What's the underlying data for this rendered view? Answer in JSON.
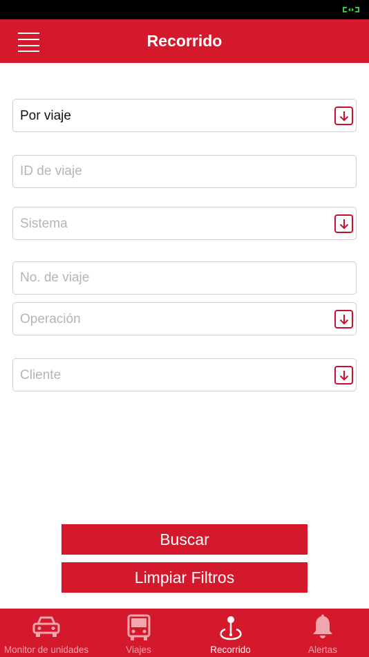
{
  "header": {
    "title": "Recorrido"
  },
  "form": {
    "filter_type": {
      "value": "Por viaje"
    },
    "trip_id": {
      "placeholder": "ID de viaje"
    },
    "system": {
      "placeholder": "Sistema"
    },
    "trip_number": {
      "placeholder": "No. de viaje"
    },
    "operation": {
      "placeholder": "Operación"
    },
    "client": {
      "placeholder": "Cliente"
    }
  },
  "buttons": {
    "search": "Buscar",
    "clear": "Limpiar Filtros"
  },
  "tabbar": {
    "items": [
      {
        "label": "Monitor de unidades",
        "icon": "car-icon",
        "active": false
      },
      {
        "label": "Viajes",
        "icon": "bus-icon",
        "active": false
      },
      {
        "label": "Recorrido",
        "icon": "route-pin-icon",
        "active": true
      },
      {
        "label": "Alertas",
        "icon": "bell-icon",
        "active": false
      }
    ]
  },
  "colors": {
    "brand_red": "#d4192c",
    "icon_red": "#c8102e",
    "border_gray": "#cfcfcf",
    "placeholder_gray": "#b5b5b5",
    "inactive_tab": "#f1a5ad",
    "battery_green": "#2ecc40"
  }
}
